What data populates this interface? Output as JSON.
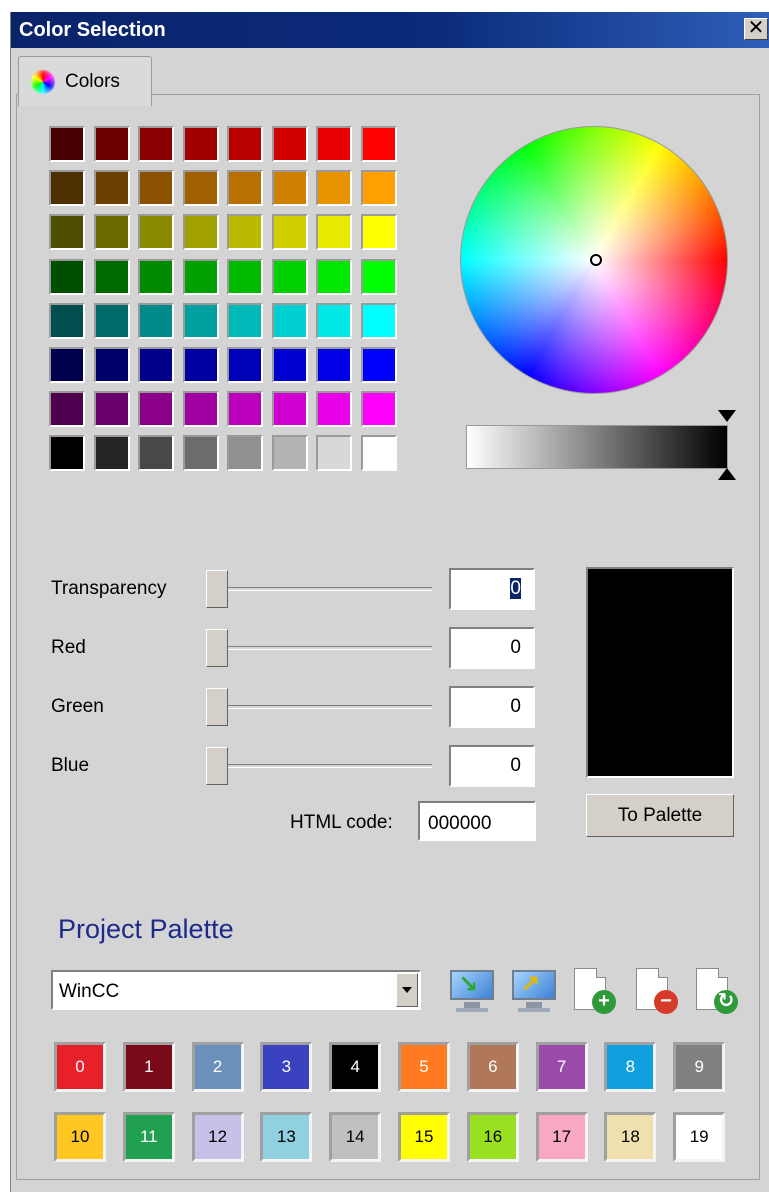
{
  "window": {
    "title": "Color Selection",
    "close_label": "✕"
  },
  "tab": {
    "label": "Colors"
  },
  "swatch_grid": {
    "rows": [
      [
        "#4a0000",
        "#6a0000",
        "#8a0000",
        "#a00000",
        "#ba0000",
        "#d00000",
        "#e80000",
        "#ff0000"
      ],
      [
        "#4e3000",
        "#6a4000",
        "#8a5200",
        "#a06000",
        "#b87000",
        "#d08000",
        "#e89200",
        "#ffa000"
      ],
      [
        "#4e4e00",
        "#6a6a00",
        "#8a8a00",
        "#a0a000",
        "#baba00",
        "#d0d000",
        "#e8e800",
        "#ffff00"
      ],
      [
        "#004e00",
        "#006a00",
        "#008a00",
        "#00a000",
        "#00ba00",
        "#00d000",
        "#00e800",
        "#00ff00"
      ],
      [
        "#004e4e",
        "#006a6a",
        "#008a8a",
        "#00a0a0",
        "#00baba",
        "#00d0d0",
        "#00e8e8",
        "#00ffff"
      ],
      [
        "#00004e",
        "#00006a",
        "#00008a",
        "#0000a0",
        "#0000ba",
        "#0000d0",
        "#0000e8",
        "#0000ff"
      ],
      [
        "#4e004e",
        "#6a006a",
        "#8a008a",
        "#a000a0",
        "#ba00ba",
        "#d000d0",
        "#e800e8",
        "#ff00ff"
      ],
      [
        "#000000",
        "#242424",
        "#484848",
        "#6c6c6c",
        "#909090",
        "#b4b4b4",
        "#d8d8d8",
        "#ffffff"
      ]
    ]
  },
  "sliders": [
    {
      "label": "Transparency",
      "value": "0",
      "selected": true
    },
    {
      "label": "Red",
      "value": "0",
      "selected": false
    },
    {
      "label": "Green",
      "value": "0",
      "selected": false
    },
    {
      "label": "Blue",
      "value": "0",
      "selected": false
    }
  ],
  "html_code": {
    "label": "HTML code:",
    "value": "000000"
  },
  "preview": {
    "color": "#000000"
  },
  "to_palette_label": "To Palette",
  "project_palette": {
    "title": "Project Palette",
    "selected": "WinCC",
    "colors": [
      {
        "n": "0",
        "bg": "#e8202a",
        "fg": "#ffffff"
      },
      {
        "n": "1",
        "bg": "#7a0a1a",
        "fg": "#ffffff"
      },
      {
        "n": "2",
        "bg": "#6a90bc",
        "fg": "#ffffff"
      },
      {
        "n": "3",
        "bg": "#3a42c0",
        "fg": "#ffffff"
      },
      {
        "n": "4",
        "bg": "#000000",
        "fg": "#ffffff"
      },
      {
        "n": "5",
        "bg": "#ff7a20",
        "fg": "#ffffff"
      },
      {
        "n": "6",
        "bg": "#b07858",
        "fg": "#ffffff"
      },
      {
        "n": "7",
        "bg": "#9a4aa8",
        "fg": "#ffffff"
      },
      {
        "n": "8",
        "bg": "#10a0e0",
        "fg": "#ffffff"
      },
      {
        "n": "9",
        "bg": "#808080",
        "fg": "#ffffff"
      },
      {
        "n": "10",
        "bg": "#ffc820",
        "fg": "#000000"
      },
      {
        "n": "11",
        "bg": "#20a050",
        "fg": "#ffffff"
      },
      {
        "n": "12",
        "bg": "#c8c0e8",
        "fg": "#000000"
      },
      {
        "n": "13",
        "bg": "#90d0e0",
        "fg": "#000000"
      },
      {
        "n": "14",
        "bg": "#c0c0c0",
        "fg": "#000000"
      },
      {
        "n": "15",
        "bg": "#ffff00",
        "fg": "#000000"
      },
      {
        "n": "16",
        "bg": "#98e020",
        "fg": "#000000"
      },
      {
        "n": "17",
        "bg": "#f8a8c0",
        "fg": "#000000"
      },
      {
        "n": "18",
        "bg": "#f0e0b0",
        "fg": "#000000"
      },
      {
        "n": "19",
        "bg": "#ffffff",
        "fg": "#000000"
      }
    ],
    "tools": [
      {
        "name": "import-palette-icon",
        "kind": "monitor",
        "glyph": "↘",
        "glyph_color": "#2fa82f"
      },
      {
        "name": "export-palette-icon",
        "kind": "monitor",
        "glyph": "↗",
        "glyph_color": "#e8b800"
      },
      {
        "name": "add-palette-icon",
        "kind": "doc",
        "glyph": "+",
        "glyph_color": "#2f9a3a"
      },
      {
        "name": "delete-palette-icon",
        "kind": "doc",
        "glyph": "−",
        "glyph_color": "#d83a2a"
      },
      {
        "name": "reset-palette-icon",
        "kind": "doc",
        "glyph": "↻",
        "glyph_color": "#2f9a3a"
      }
    ]
  }
}
